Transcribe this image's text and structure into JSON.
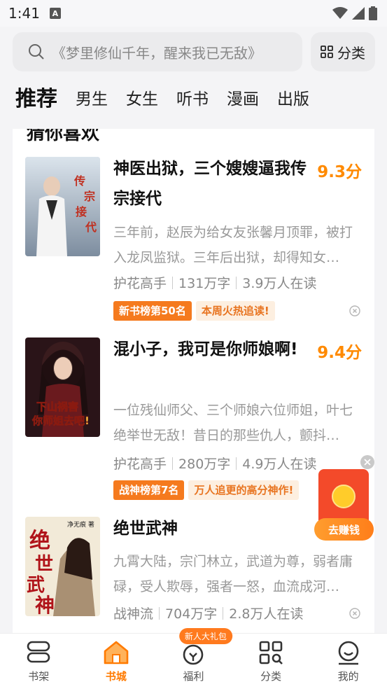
{
  "status": {
    "time": "1:41",
    "notification_icon": "a-icon"
  },
  "search": {
    "placeholder": "《梦里修仙千年，醒来我已无敌》",
    "category_label": "分类"
  },
  "tabs": [
    {
      "label": "推荐",
      "active": true
    },
    {
      "label": "男生"
    },
    {
      "label": "女生"
    },
    {
      "label": "听书"
    },
    {
      "label": "漫画"
    },
    {
      "label": "出版"
    }
  ],
  "section": {
    "title": "猜你喜欢"
  },
  "books": [
    {
      "title": "神医出狱，三个嫂嫂逼我传宗接代",
      "score": "9.3分",
      "description": "三年前，赵辰为给女友张馨月顶罪，被打入龙凤监狱。三年后出狱，却得知女…",
      "category": "护花高手",
      "words": "131万字",
      "readers": "3.9万人在读",
      "rank_tag": "新书榜第50名",
      "hot_tag": "本周火热追读!",
      "cover_text": "传宗接代"
    },
    {
      "title": "混小子，我可是你师娘啊!",
      "score": "9.4分",
      "description": "一位残仙师父、三个师娘六位师姐，叶七绝举世无敌！昔日的那些仇人，颤抖…",
      "category": "护花高手",
      "words": "280万字",
      "readers": "4.9万人在读",
      "rank_tag": "战神榜第7名",
      "hot_tag": "万人追更的高分神作!",
      "cover_text": "下山祸害你师姐去吧!"
    },
    {
      "title": "绝世武神",
      "description": "九霄大陆，宗门林立，武道为尊，弱者庸碌，受人欺辱，强者一怒，血流成河…",
      "category": "战神流",
      "words": "704万字",
      "readers": "2.8万人在读",
      "cover_text": "绝世武神",
      "cover_author": "净无痕 著"
    }
  ],
  "float_widget": {
    "label": "去赚钱"
  },
  "bottom_nav": [
    {
      "label": "书架",
      "icon": "bookshelf-icon"
    },
    {
      "label": "书城",
      "icon": "home-icon",
      "active": true
    },
    {
      "label": "福利",
      "icon": "gift-icon",
      "badge": "新人大礼包"
    },
    {
      "label": "分类",
      "icon": "grid-search-icon"
    },
    {
      "label": "我的",
      "icon": "smile-icon"
    }
  ],
  "colors": {
    "accent": "#ff7a00",
    "score": "#ff8a00",
    "rank_tag": "#f57a1e"
  }
}
